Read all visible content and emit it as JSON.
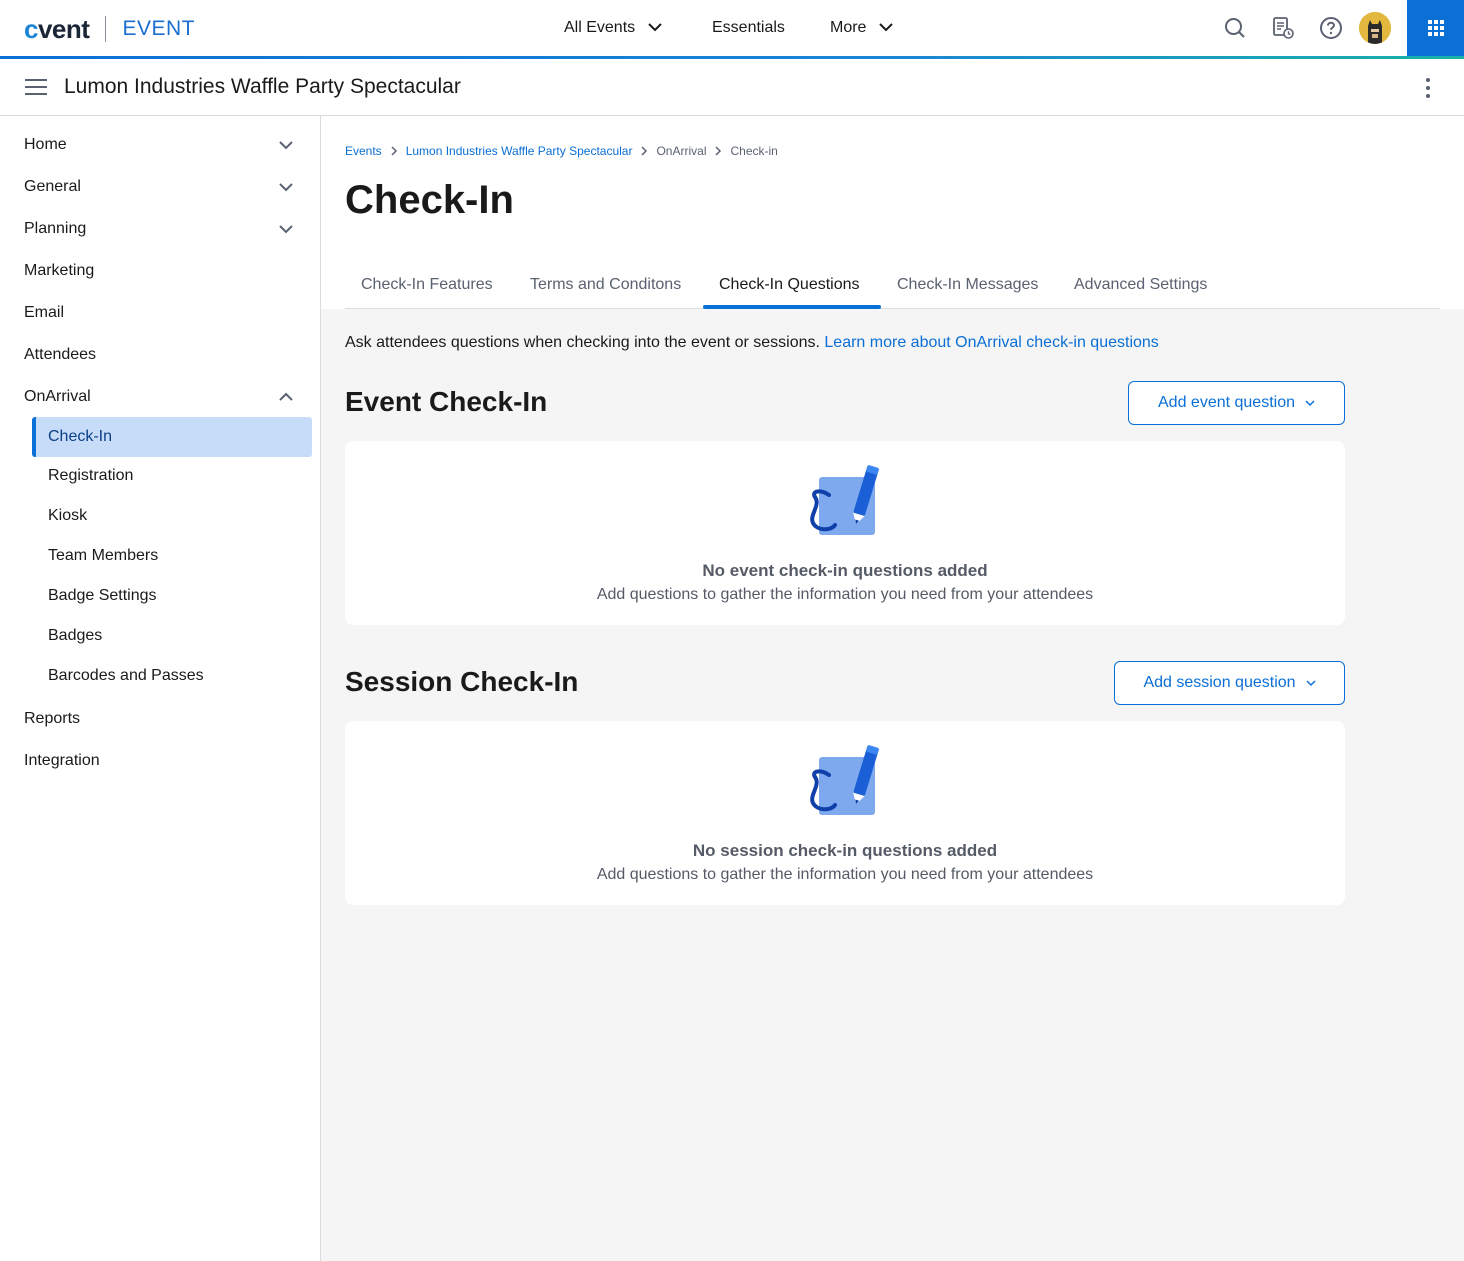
{
  "app": {
    "logo_text": "cvent",
    "product": "EVENT"
  },
  "topnav": {
    "all_events": "All Events",
    "essentials": "Essentials",
    "more": "More",
    "icons": [
      "search-icon",
      "calendar-clock-icon",
      "help-icon",
      "avatar",
      "apps-grid-icon"
    ]
  },
  "subheader": {
    "event_title": "Lumon Industries Waffle Party Spectacular"
  },
  "sidebar": {
    "items": [
      {
        "label": "Home",
        "expandable": true
      },
      {
        "label": "General",
        "expandable": true
      },
      {
        "label": "Planning",
        "expandable": true
      },
      {
        "label": "Marketing"
      },
      {
        "label": "Email"
      },
      {
        "label": "Attendees"
      },
      {
        "label": "OnArrival",
        "expanded": true
      },
      {
        "label": "Reports"
      },
      {
        "label": "Integration"
      }
    ],
    "onarrival_children": [
      {
        "label": "Check-In",
        "active": true
      },
      {
        "label": "Registration"
      },
      {
        "label": "Kiosk"
      },
      {
        "label": "Team Members"
      },
      {
        "label": "Badge Settings"
      },
      {
        "label": "Badges"
      },
      {
        "label": "Barcodes and Passes"
      }
    ]
  },
  "breadcrumb": [
    "Events",
    "Lumon Industries Waffle Party Spectacular",
    "OnArrival",
    "Check-in"
  ],
  "page": {
    "title": "Check-In",
    "tabs": [
      "Check-In Features",
      "Terms and Conditons",
      "Check-In Questions",
      "Check-In Messages",
      "Advanced Settings"
    ],
    "active_tab": "Check-In Questions",
    "intro_text": "Ask attendees questions when checking into the event or sessions.",
    "intro_link": "Learn more about OnArrival check-in questions"
  },
  "event_section": {
    "title": "Event Check-In",
    "button": "Add event question",
    "empty_title": "No event check-in questions added",
    "empty_sub": "Add questions to gather the information you need from your attendees"
  },
  "session_section": {
    "title": "Session Check-In",
    "button": "Add session question",
    "empty_title": "No session check-in questions added",
    "empty_sub": "Add questions to gather the information you need from your attendees"
  },
  "colors": {
    "primary": "#0a6fd6",
    "active_bg": "#c7dcf8",
    "content_bg": "#f5f5f5"
  }
}
